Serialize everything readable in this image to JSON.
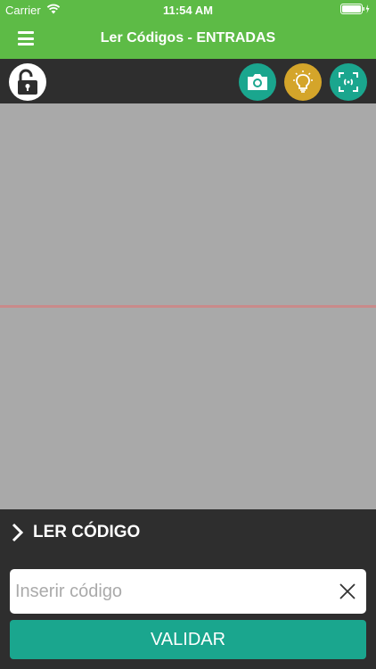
{
  "status_bar": {
    "carrier": "Carrier",
    "time": "11:54 AM"
  },
  "navbar": {
    "title": "Ler Códigos - ENTRADAS",
    "menu_icon": "hamburger-menu-icon"
  },
  "toolbar": {
    "lock_icon": "unlock-icon",
    "camera_icon": "camera-icon",
    "light_icon": "lightbulb-icon",
    "scan_icon": "scan-frame-icon"
  },
  "read_section": {
    "label": "LER CÓDIGO"
  },
  "code_input": {
    "value": "",
    "placeholder": "Inserir código"
  },
  "validate_button": {
    "label": "VALIDAR"
  },
  "colors": {
    "header_green": "#5dbb46",
    "accent_teal": "#1aa68e",
    "light_yellow": "#d4a52a",
    "dark_bg": "#2e2e2e",
    "viewport_gray": "#a9a9a9",
    "scan_line": "#c98a8a"
  }
}
